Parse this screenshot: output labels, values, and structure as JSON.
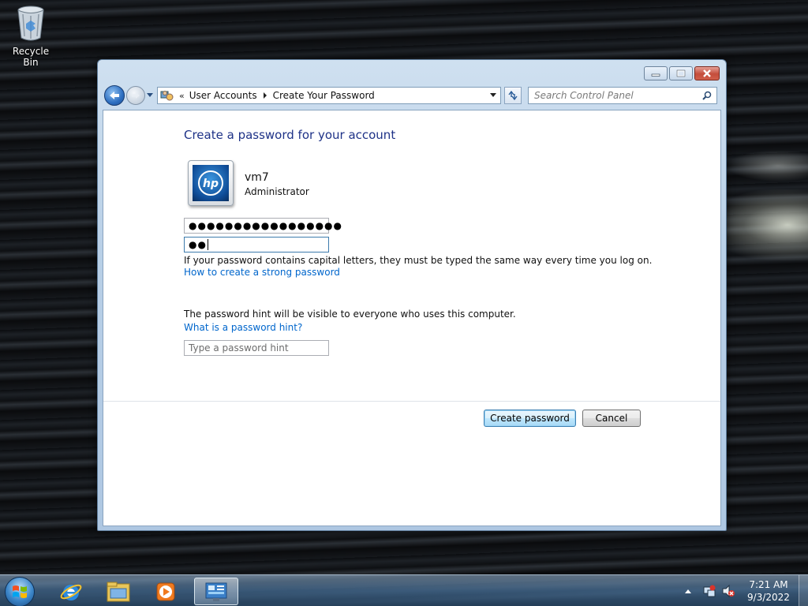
{
  "desktop": {
    "icons": [
      {
        "label": "Recycle Bin",
        "icon": "recycle-bin-icon"
      }
    ]
  },
  "window": {
    "controls": {
      "minimize": "minimize-icon",
      "maximize": "maximize-icon",
      "close": "close-icon"
    },
    "address": {
      "overflow": "«",
      "crumbs": [
        "User Accounts",
        "Create Your Password"
      ]
    },
    "search": {
      "placeholder": "Search Control Panel"
    },
    "content": {
      "heading": "Create a password for your account",
      "user": {
        "name": "vm7",
        "role": "Administrator",
        "avatar_text": "hp"
      },
      "new_password": {
        "value": "●●●●●●●●●●●●●●●●●"
      },
      "confirm_password": {
        "value": "●●"
      },
      "caps_note": "If your password contains capital letters, they must be typed the same way every time you log on.",
      "strong_link": "How to create a strong password",
      "hint": {
        "placeholder": "Type a password hint"
      },
      "hint_note": "The password hint will be visible to everyone who uses this computer.",
      "hint_link": "What is a password hint?",
      "buttons": {
        "create": "Create password",
        "cancel": "Cancel"
      }
    }
  },
  "taskbar": {
    "items": [
      "internet-explorer-icon",
      "windows-explorer-icon",
      "media-player-icon",
      "control-panel-icon"
    ],
    "active_item": "control-panel-icon",
    "clock": {
      "time": "7:21 AM",
      "date": "9/3/2022"
    },
    "tray_icons": [
      "network-icon",
      "volume-muted-icon"
    ]
  },
  "colors": {
    "heading": "#1e3287",
    "link": "#0066cc",
    "accent": "#3c7fb1"
  }
}
